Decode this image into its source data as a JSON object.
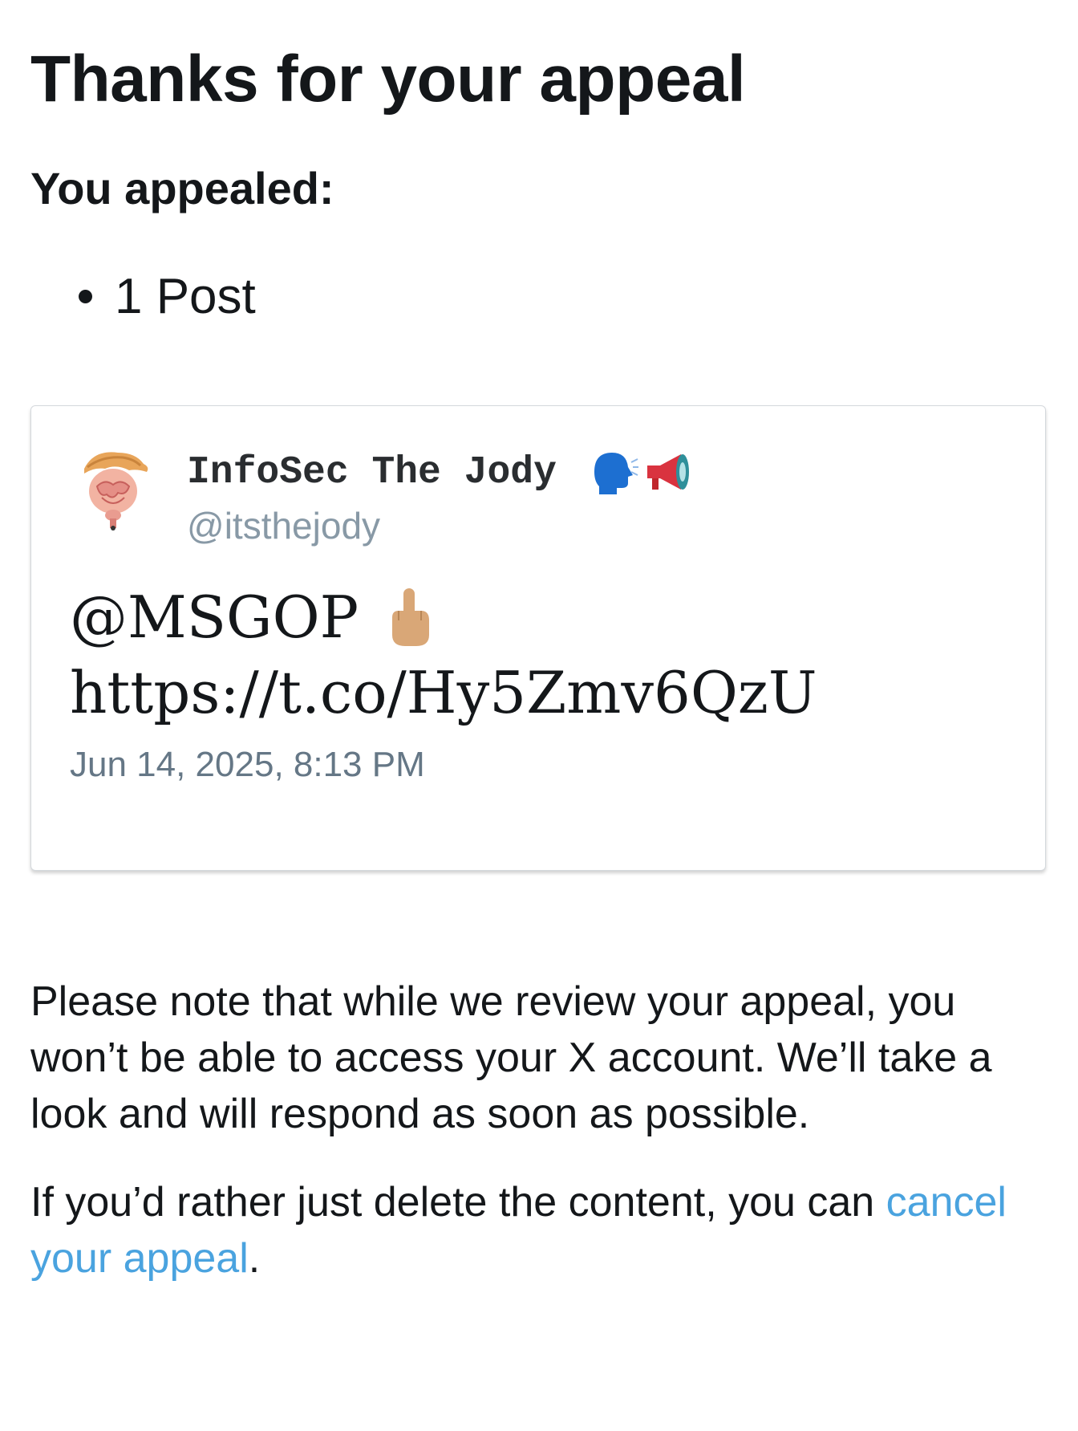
{
  "header": {
    "title": "Thanks for your appeal",
    "subtitle": "You appealed:"
  },
  "appealed_items": [
    {
      "label": "1 Post"
    }
  ],
  "post": {
    "author_name": "InfoSec The Jody",
    "author_handle": "@itsthejody",
    "text_line1": "@MSGOP",
    "text_line2": "https://t.co/Hy5Zmv6QzU",
    "timestamp": "Jun 14, 2025, 8:13 PM",
    "icons": [
      "speaking-head-icon",
      "megaphone-icon",
      "middle-finger-icon"
    ]
  },
  "notice": {
    "paragraph1": "Please note that while we review your appeal, you won’t be able to access your X account. We’ll take a look and will respond as soon as possible.",
    "paragraph2_prefix": "If you’d rather just delete the content, you can ",
    "cancel_link": "cancel your appeal",
    "paragraph2_suffix": "."
  },
  "colors": {
    "link": "#4aa3df",
    "handle": "#8899a6",
    "text": "#14171a"
  }
}
